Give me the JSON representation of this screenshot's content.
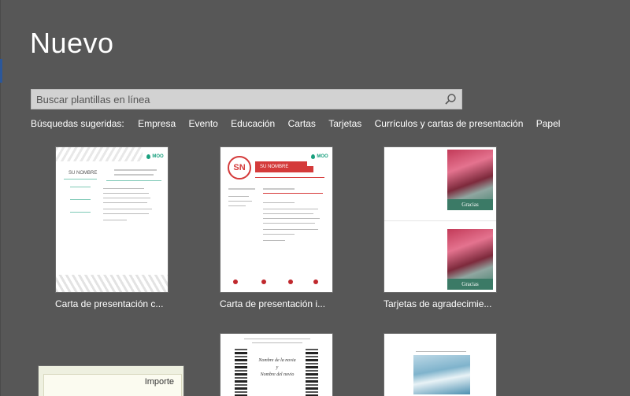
{
  "page": {
    "title": "Nuevo"
  },
  "search": {
    "placeholder": "Buscar plantillas en línea"
  },
  "suggested": {
    "label": "Búsquedas sugeridas:",
    "items": [
      "Empresa",
      "Evento",
      "Educación",
      "Cartas",
      "Tarjetas",
      "Currículos y cartas de presentación",
      "Papel"
    ]
  },
  "templates": [
    {
      "caption": "Carta de presentación c...",
      "name_text": "SU NOMBRE",
      "brand": "MOO"
    },
    {
      "caption": "Carta de presentación i...",
      "initials": "SN",
      "name_text": "SU NOMBRE",
      "brand": "MOO"
    },
    {
      "caption": "Tarjetas de agradecimie...",
      "card_text": "Gracias"
    },
    {
      "caption": "",
      "label": "Importe"
    },
    {
      "caption": "",
      "script_lines": [
        "Nombre de la novia",
        "y",
        "Nombre del novio"
      ]
    },
    {
      "caption": ""
    }
  ],
  "colors": {
    "background": "#575757",
    "accent": "#2b579a",
    "search_bg": "#d2d2d2"
  }
}
